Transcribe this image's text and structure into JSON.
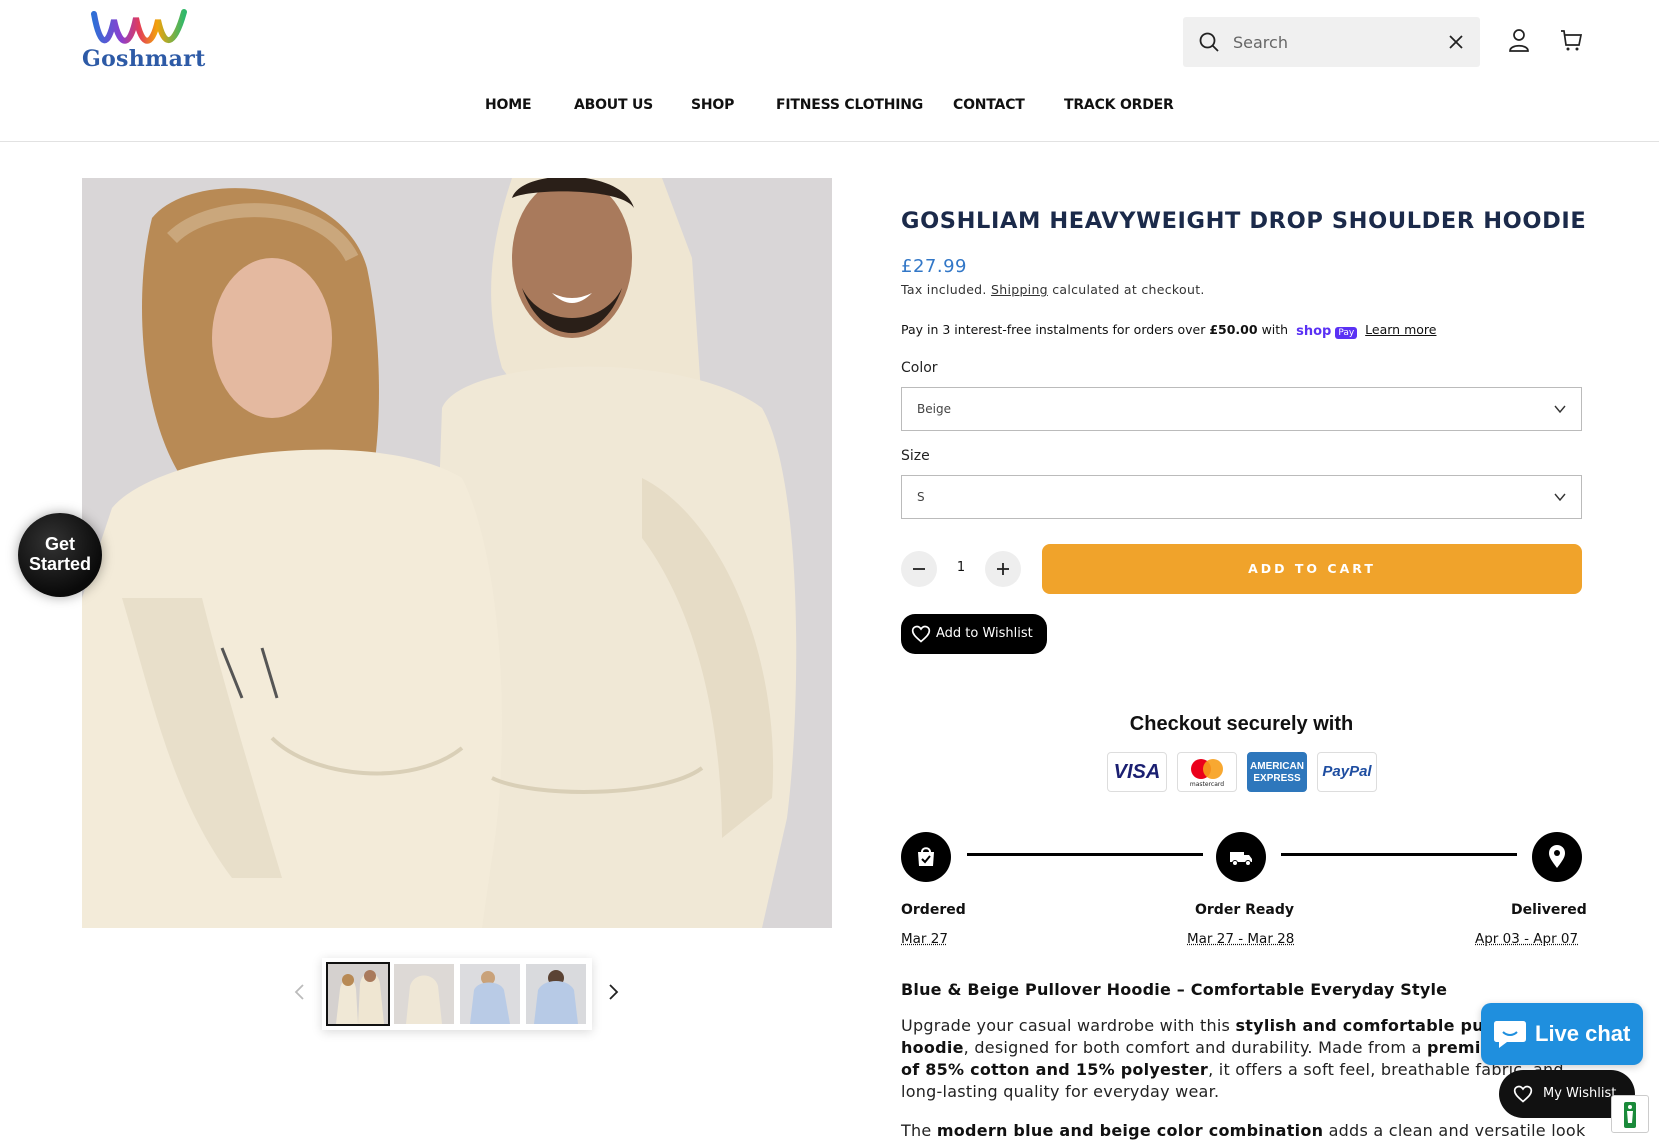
{
  "header": {
    "logo_text": "Goshmart",
    "search_placeholder": "Search",
    "nav": [
      "HOME",
      "ABOUT US",
      "SHOP",
      "FITNESS CLOTHING",
      "CONTACT",
      "TRACK ORDER"
    ]
  },
  "gallery": {
    "thumbnails": [
      "thumb-couple-beige",
      "thumb-beige-hoodie",
      "thumb-blue-hoodie-woman",
      "thumb-blue-hoodie-man"
    ],
    "active_index": 0
  },
  "popup": {
    "get_started_line1": "Get",
    "get_started_line2": "Started"
  },
  "product": {
    "title": "GOSHLIAM HEAVYWEIGHT DROP SHOULDER HOODIE",
    "price": "£27.99",
    "tax_prefix": "Tax included.",
    "tax_link": "Shipping",
    "tax_suffix": "calculated at checkout.",
    "pay_prefix": "Pay in 3 interest-free instalments for orders over",
    "pay_amount": "£50.00",
    "pay_with": "with",
    "shop_pay": "shop",
    "shop_pay_badge": "Pay",
    "learn_more": "Learn more",
    "color_label": "Color",
    "color_value": "Beige",
    "size_label": "Size",
    "size_value": "S",
    "quantity": "1",
    "add_to_cart": "ADD TO CART",
    "add_to_wishlist": "Add to Wishlist"
  },
  "checkout": {
    "title": "Checkout securely with",
    "cards": [
      "VISA",
      "mastercard",
      "AMERICAN EXPRESS",
      "PayPal"
    ]
  },
  "timeline": {
    "steps": [
      {
        "label": "Ordered",
        "date": "Mar 27"
      },
      {
        "label": "Order Ready",
        "date": "Mar 27 - Mar 28"
      },
      {
        "label": "Delivered",
        "date": "Apr 03 - Apr 07"
      }
    ]
  },
  "description": {
    "heading": "Blue & Beige Pullover Hoodie – Comfortable Everyday Style",
    "p1_a": "Upgrade your casual wardrobe with this ",
    "p1_b": "stylish and comfortable pullover hoodie",
    "p1_c": ", designed for both comfort and durability. Made from a ",
    "p1_d": "premium blend of 85% cotton and 15% polyester",
    "p1_e": ", it offers a soft feel, breathable fabric, and long-lasting quality for everyday wear.",
    "p2_a": "The ",
    "p2_b": "modern blue and beige color combination",
    "p2_c": " adds a clean and versatile look"
  },
  "widgets": {
    "live_chat": "Live chat",
    "my_wishlist": "My Wishlist"
  },
  "colors": {
    "accent_orange": "#f0a32b",
    "price_blue": "#3277c7",
    "livechat_blue": "#1f8fde"
  }
}
